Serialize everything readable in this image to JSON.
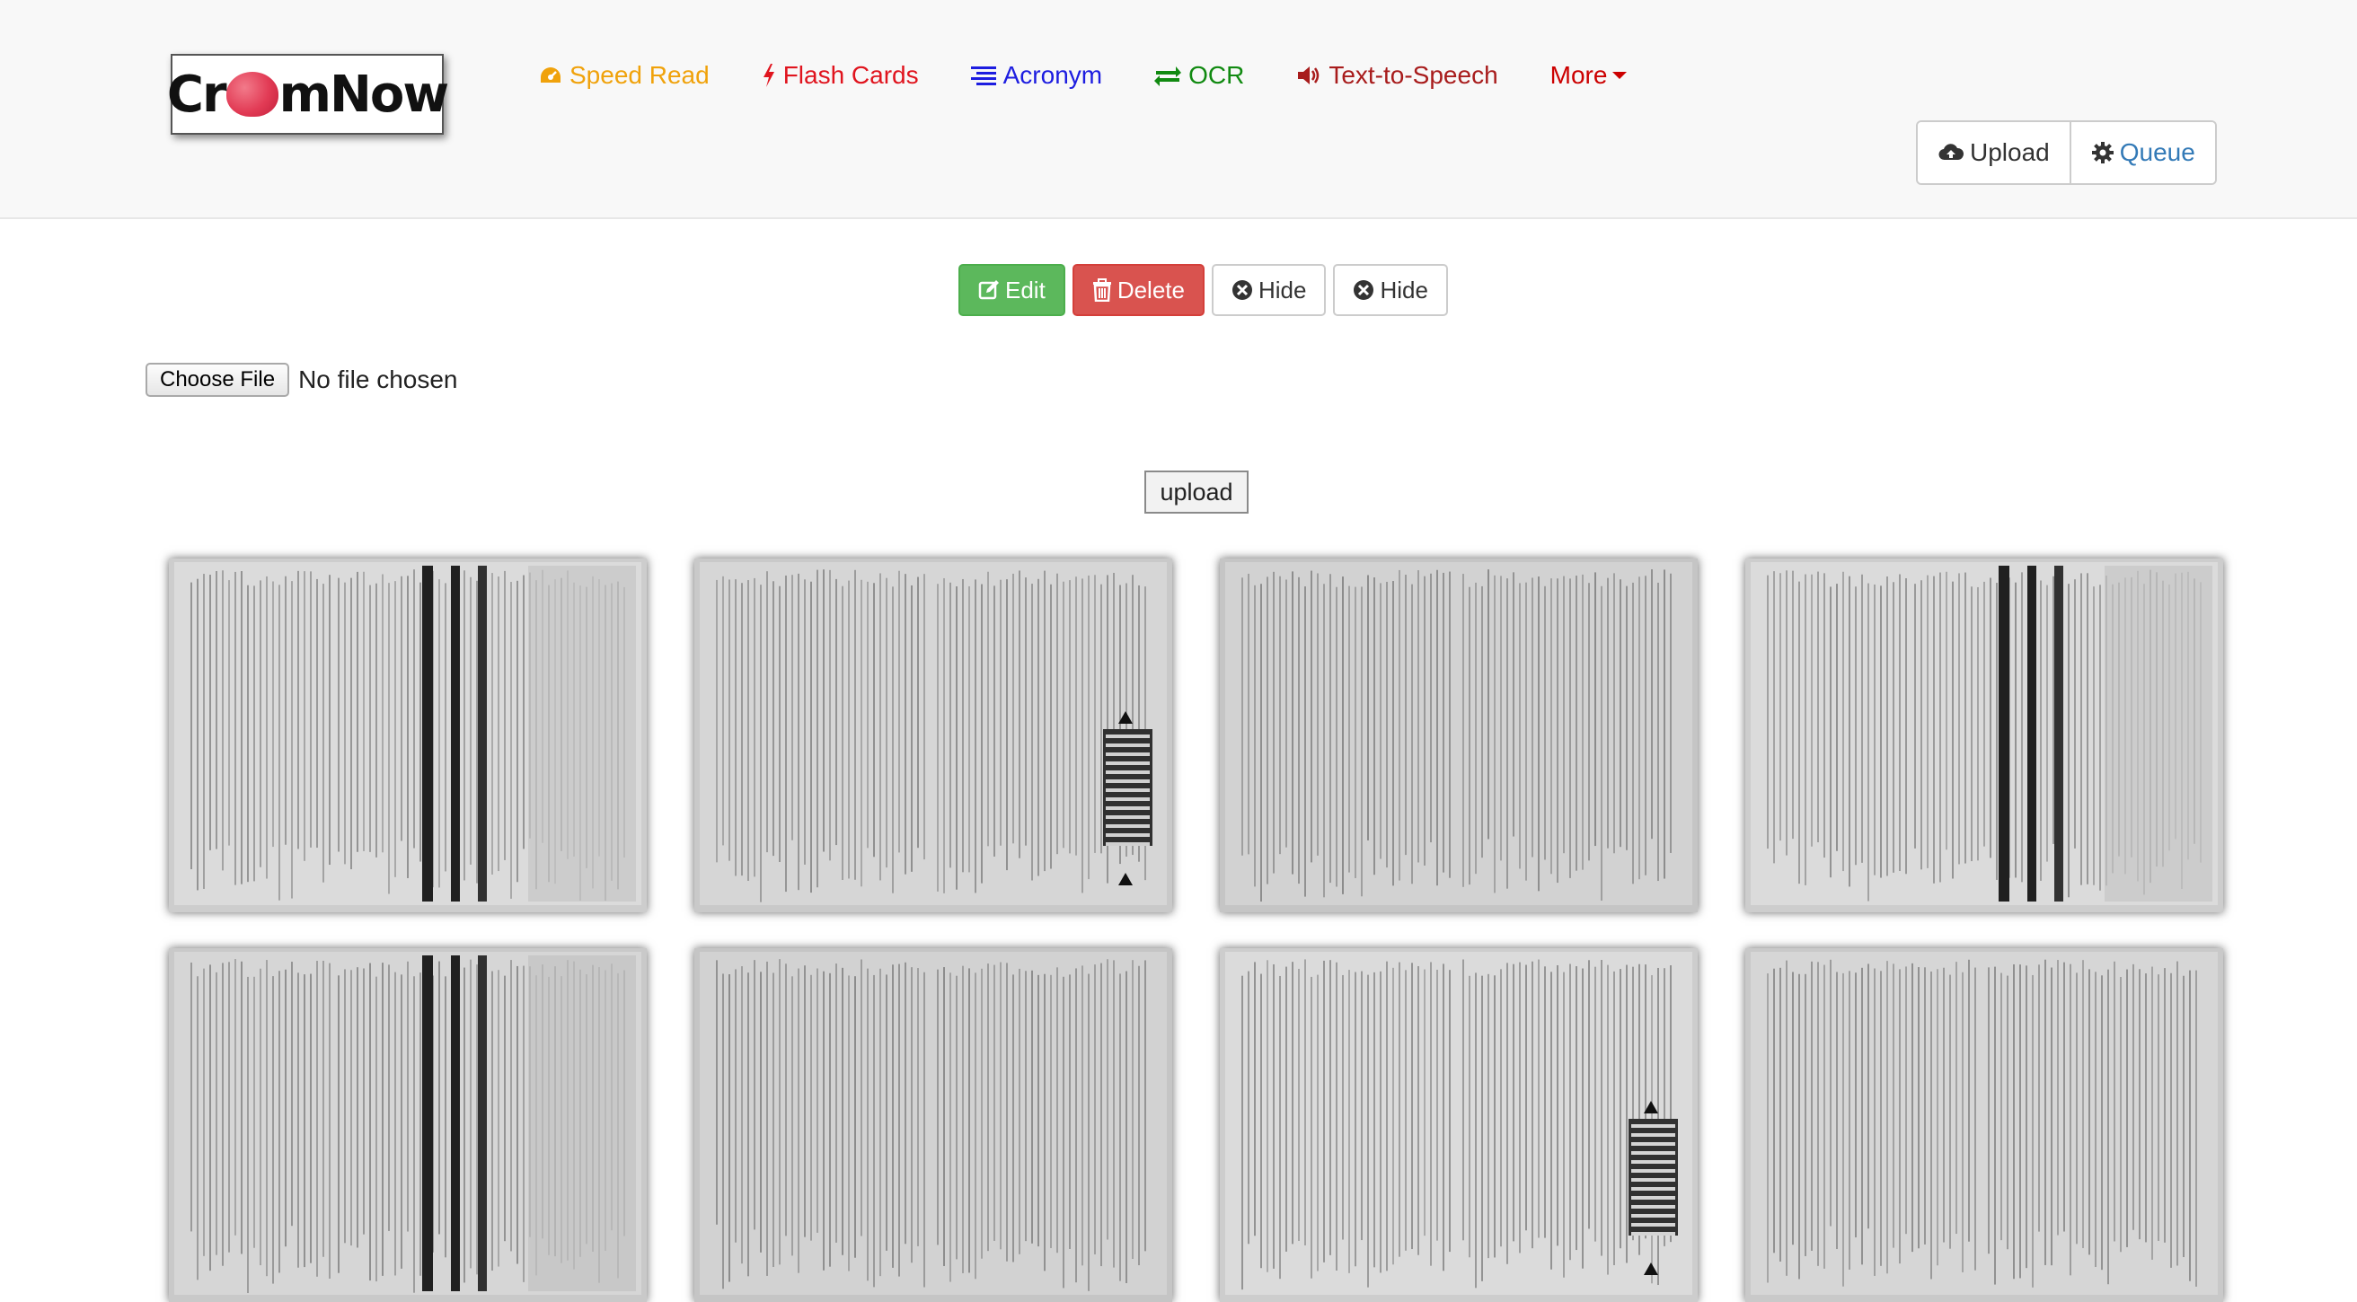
{
  "brand": {
    "logo_left": "Cr",
    "logo_right": "mNow"
  },
  "nav": {
    "links": [
      {
        "label": "Speed Read",
        "color": "#f0a20b",
        "icon": "dashboard-icon"
      },
      {
        "label": "Flash Cards",
        "color": "#e0141e",
        "icon": "lightning-icon"
      },
      {
        "label": "Acronym",
        "color": "#1d1de0",
        "icon": "align-icon"
      },
      {
        "label": "OCR",
        "color": "#118a11",
        "icon": "transfer-icon"
      },
      {
        "label": "Text-to-Speech",
        "color": "#a81c1c",
        "icon": "volume-icon"
      },
      {
        "label": "More",
        "color": "#cc0000",
        "icon": "caret-down-icon"
      }
    ],
    "upload_label": "Upload",
    "queue_label": "Queue",
    "queue_color": "#337ab7"
  },
  "toolbar": {
    "edit_label": "Edit",
    "delete_label": "Delete",
    "hide1_label": "Hide",
    "hide2_label": "Hide"
  },
  "file_input": {
    "button_label": "Choose File",
    "status": "No file chosen"
  },
  "upload_button_label": "upload",
  "thumbnails": [
    {
      "page": "hands-on-activity-2c"
    },
    {
      "page": "basic-electricity"
    },
    {
      "page": "setup-questions"
    },
    {
      "page": "hands-on-activity-2c"
    },
    {
      "page": "hands-on-activity-2c"
    },
    {
      "page": "setup-questions"
    },
    {
      "page": "basic-electricity"
    },
    {
      "page": "text-columns"
    }
  ]
}
